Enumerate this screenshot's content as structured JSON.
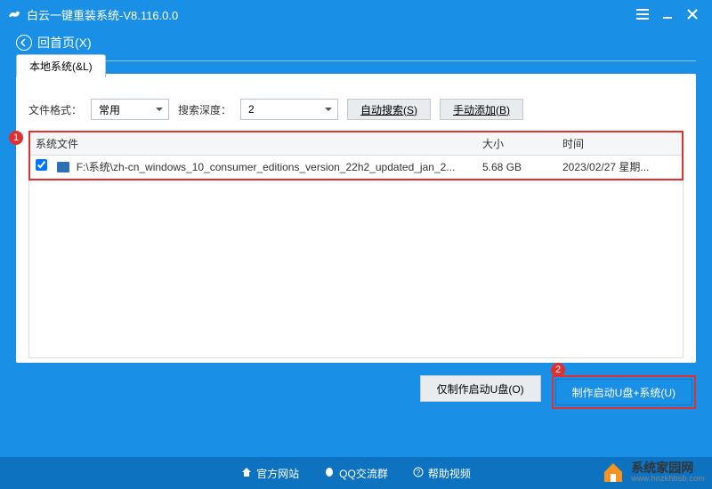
{
  "app": {
    "title": "白云一键重装系统-V8.116.0.0"
  },
  "nav": {
    "back": "回首页(X)"
  },
  "tab": {
    "label": "本地系统(&L)"
  },
  "filters": {
    "file_format_label": "文件格式：",
    "file_format_value": "常用",
    "depth_label": "搜索深度：",
    "depth_value": "2",
    "auto_search": "自动搜索(S)",
    "manual_add": "手动添加(B)"
  },
  "table": {
    "hdr_file": "系统文件",
    "hdr_size": "大小",
    "hdr_time": "时间",
    "rows": [
      {
        "checked": true,
        "path": "F:\\系统\\zh-cn_windows_10_consumer_editions_version_22h2_updated_jan_2...",
        "size": "5.68 GB",
        "time": "2023/02/27 星期..."
      }
    ]
  },
  "actions": {
    "make_only": "仅制作启动U盘(O)",
    "make_sys": "制作启动U盘+系统(U)"
  },
  "badge1": "1",
  "badge2": "2",
  "footer": {
    "site": "官方网站",
    "qq": "QQ交流群",
    "help": "帮助视频"
  },
  "watermark": {
    "cn": "系统家园网",
    "url": "www.hnzkhbsb.com"
  }
}
